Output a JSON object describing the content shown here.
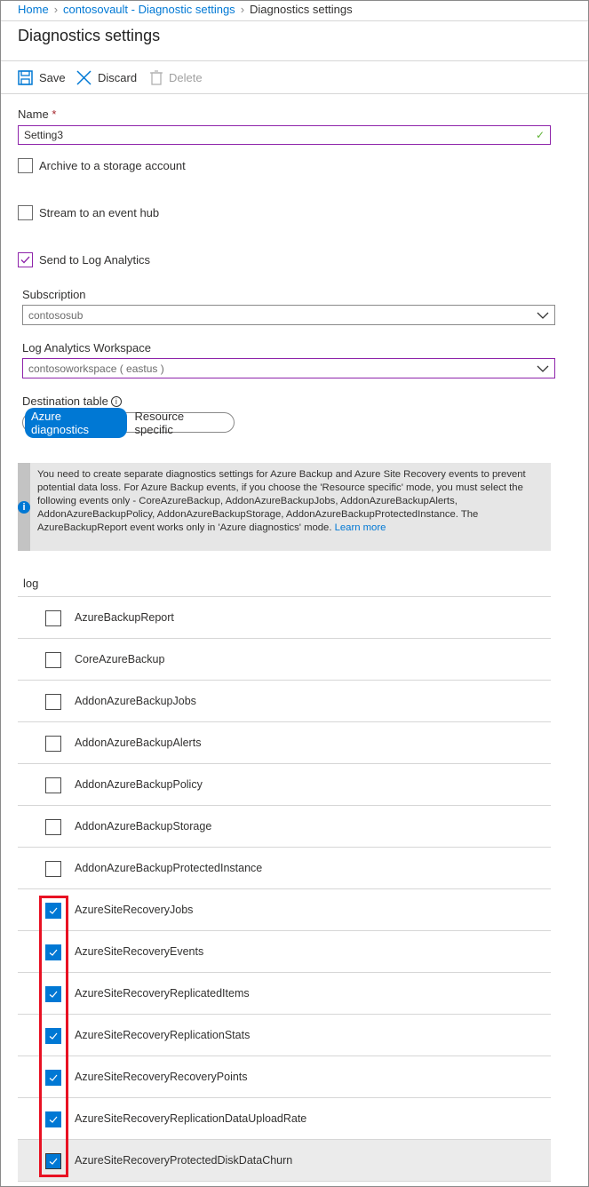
{
  "breadcrumb": [
    {
      "label": "Home"
    },
    {
      "label": "contosovault - Diagnostic settings"
    },
    {
      "label": "Diagnostics settings"
    }
  ],
  "title": "Diagnostics settings",
  "toolbar": {
    "save": "Save",
    "discard": "Discard",
    "delete": "Delete"
  },
  "form": {
    "name_label": "Name",
    "required_mark": "*",
    "name_value": "Setting3",
    "archive": {
      "label": "Archive to a storage account",
      "checked": false
    },
    "stream": {
      "label": "Stream to an event hub",
      "checked": false
    },
    "log_analytics": {
      "label": "Send to Log Analytics",
      "checked": true
    },
    "subscription_label": "Subscription",
    "subscription_value": "contososub",
    "workspace_label": "Log Analytics Workspace",
    "workspace_value": "contosoworkspace ( eastus )",
    "destination_label": "Destination table",
    "destination_options": [
      "Azure diagnostics",
      "Resource specific"
    ],
    "destination_selected": "Azure diagnostics"
  },
  "info": {
    "text": "You need to create separate diagnostics settings for Azure Backup and Azure Site Recovery events to prevent potential data loss. For Azure Backup events, if you choose the 'Resource specific' mode, you must select the following events only - CoreAzureBackup, AddonAzureBackupJobs, AddonAzureBackupAlerts, AddonAzureBackupPolicy, AddonAzureBackupStorage, AddonAzureBackupProtectedInstance. The AzureBackupReport event works only in 'Azure diagnostics' mode.",
    "link": "Learn more"
  },
  "log": {
    "header": "log",
    "items": [
      {
        "name": "AzureBackupReport",
        "checked": false
      },
      {
        "name": "CoreAzureBackup",
        "checked": false
      },
      {
        "name": "AddonAzureBackupJobs",
        "checked": false
      },
      {
        "name": "AddonAzureBackupAlerts",
        "checked": false
      },
      {
        "name": "AddonAzureBackupPolicy",
        "checked": false
      },
      {
        "name": "AddonAzureBackupStorage",
        "checked": false
      },
      {
        "name": "AddonAzureBackupProtectedInstance",
        "checked": false
      },
      {
        "name": "AzureSiteRecoveryJobs",
        "checked": true
      },
      {
        "name": "AzureSiteRecoveryEvents",
        "checked": true
      },
      {
        "name": "AzureSiteRecoveryReplicatedItems",
        "checked": true
      },
      {
        "name": "AzureSiteRecoveryReplicationStats",
        "checked": true
      },
      {
        "name": "AzureSiteRecoveryRecoveryPoints",
        "checked": true
      },
      {
        "name": "AzureSiteRecoveryReplicationDataUploadRate",
        "checked": true
      },
      {
        "name": "AzureSiteRecoveryProtectedDiskDataChurn",
        "checked": true,
        "hovered": true
      }
    ]
  },
  "colors": {
    "accent": "#0078d4",
    "focus_border": "#8e24aa",
    "highlight": "#e81123",
    "valid": "#5fb336"
  }
}
